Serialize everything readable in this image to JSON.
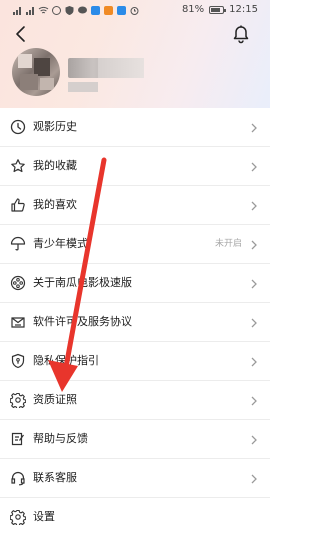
{
  "status_bar": {
    "battery": "81%",
    "time": "12:15",
    "battery_level": 0.81
  },
  "menu": {
    "items": [
      {
        "label": "观影历史",
        "icon": "clock-icon"
      },
      {
        "label": "我的收藏",
        "icon": "star-icon"
      },
      {
        "label": "我的喜欢",
        "icon": "thumbs-up-icon"
      },
      {
        "label": "青少年模式",
        "icon": "umbrella-icon",
        "value": "未开启"
      },
      {
        "label": "关于南瓜电影极速版",
        "icon": "film-reel-icon"
      },
      {
        "label": "软件许可及服务协议",
        "icon": "agreement-icon"
      },
      {
        "label": "隐私保护指引",
        "icon": "privacy-shield-icon"
      },
      {
        "label": "资质证照",
        "icon": "gear-icon"
      },
      {
        "label": "帮助与反馈",
        "icon": "feedback-icon"
      },
      {
        "label": "联系客服",
        "icon": "headset-icon"
      },
      {
        "label": "设置",
        "icon": "gear-icon"
      }
    ]
  },
  "colors": {
    "annotation_arrow": "#e8352c",
    "header_start": "#fbe4de",
    "header_end": "#e9eefb"
  }
}
